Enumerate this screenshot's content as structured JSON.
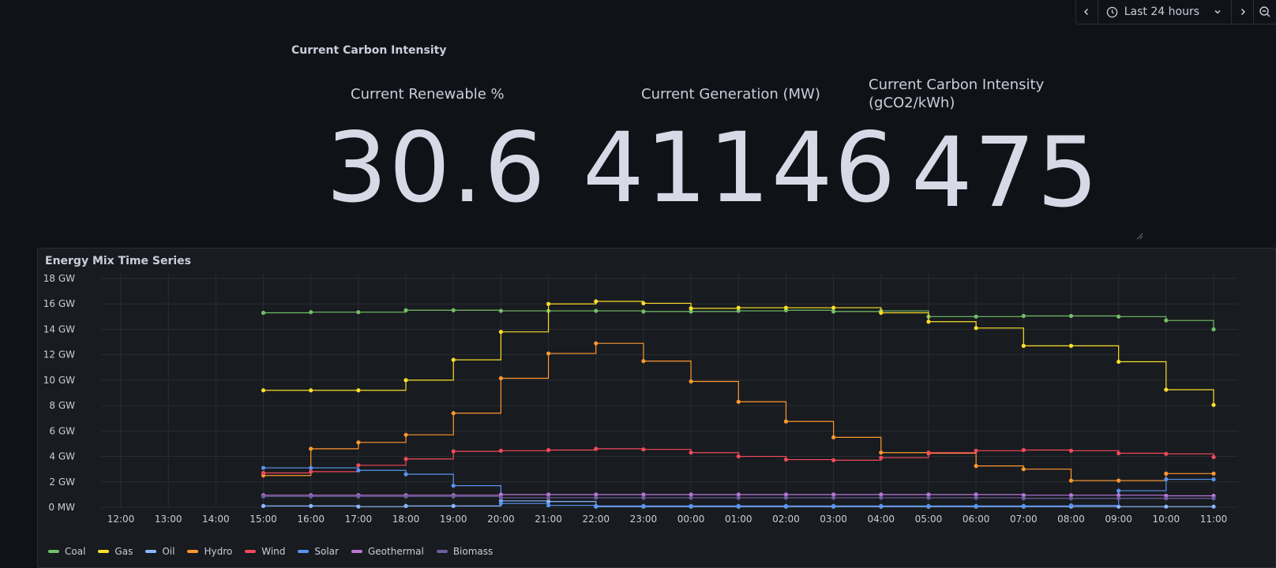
{
  "toolbar": {
    "prev_icon": "chevron-left-icon",
    "time_range": "Last 24 hours",
    "next_icon": "chevron-right-icon",
    "zoom_icon": "zoom-out-icon"
  },
  "stats": {
    "section_title": "Current Carbon Intensity",
    "renewable": {
      "title": "Current Renewable %",
      "value": "30.6"
    },
    "generation": {
      "title": "Current Generation (MW)",
      "value": "41146"
    },
    "carbon": {
      "title_line1": "Current Carbon Intensity",
      "title_line2": "(gCO2/kWh)",
      "value": "475"
    }
  },
  "timeseries": {
    "title": "Energy Mix Time Series"
  },
  "colors": {
    "Coal": "#73bf69",
    "Gas": "#fade2a",
    "Oil": "#8ab8ff",
    "Hydro": "#ff9830",
    "Wind": "#f2495c",
    "Solar": "#5794f2",
    "Geothermal": "#b877d9",
    "Biomass": "#705da0"
  },
  "chart_data": {
    "type": "line",
    "step": true,
    "x": [
      "12:00",
      "13:00",
      "14:00",
      "15:00",
      "16:00",
      "17:00",
      "18:00",
      "19:00",
      "20:00",
      "21:00",
      "22:00",
      "23:00",
      "00:00",
      "01:00",
      "02:00",
      "03:00",
      "04:00",
      "05:00",
      "06:00",
      "07:00",
      "08:00",
      "09:00",
      "10:00",
      "11:00"
    ],
    "y_ticks": [
      "0 MW",
      "2 GW",
      "4 GW",
      "6 GW",
      "8 GW",
      "10 GW",
      "12 GW",
      "14 GW",
      "16 GW",
      "18 GW"
    ],
    "ylim": [
      0,
      18
    ],
    "yunit": "GW",
    "grid": true,
    "legend_position": "bottom",
    "series": [
      {
        "name": "Coal",
        "values": [
          null,
          null,
          null,
          15.3,
          15.35,
          15.35,
          15.5,
          15.5,
          15.45,
          15.45,
          15.45,
          15.4,
          15.4,
          15.45,
          15.5,
          15.4,
          15.45,
          15.0,
          15.0,
          15.05,
          15.05,
          15.0,
          14.7,
          14.0
        ]
      },
      {
        "name": "Gas",
        "values": [
          null,
          null,
          null,
          9.2,
          9.2,
          9.2,
          10.0,
          11.6,
          13.8,
          16.0,
          16.2,
          16.05,
          15.65,
          15.7,
          15.7,
          15.7,
          15.3,
          14.6,
          14.1,
          12.7,
          12.7,
          11.45,
          9.25,
          8.05
        ]
      },
      {
        "name": "Oil",
        "values": [
          null,
          null,
          null,
          0.1,
          0.1,
          0.05,
          0.1,
          0.1,
          0.5,
          0.45,
          0.05,
          0.05,
          0.05,
          0.05,
          0.05,
          0.05,
          0.05,
          0.05,
          0.05,
          0.05,
          0.05,
          0.05,
          0.05,
          0.05
        ]
      },
      {
        "name": "Hydro",
        "values": [
          null,
          null,
          null,
          2.5,
          4.6,
          5.1,
          5.7,
          7.4,
          10.15,
          12.1,
          12.9,
          11.5,
          9.9,
          8.3,
          6.75,
          5.5,
          4.3,
          4.25,
          3.25,
          3.0,
          2.1,
          2.1,
          2.65,
          2.65
        ]
      },
      {
        "name": "Wind",
        "values": [
          null,
          null,
          null,
          2.7,
          2.8,
          3.3,
          3.8,
          4.4,
          4.45,
          4.5,
          4.6,
          4.55,
          4.3,
          4.0,
          3.75,
          3.7,
          3.9,
          4.3,
          4.45,
          4.5,
          4.45,
          4.25,
          4.2,
          3.95
        ]
      },
      {
        "name": "Solar",
        "values": [
          null,
          null,
          null,
          3.1,
          3.1,
          2.9,
          2.6,
          1.7,
          0.3,
          0.15,
          0.1,
          0.1,
          0.1,
          0.1,
          0.1,
          0.1,
          0.1,
          0.1,
          0.1,
          0.1,
          0.15,
          1.3,
          2.2,
          2.2
        ]
      },
      {
        "name": "Geothermal",
        "values": [
          null,
          null,
          null,
          0.95,
          0.95,
          0.95,
          0.95,
          0.95,
          1.0,
          1.0,
          1.0,
          1.0,
          1.0,
          1.0,
          1.0,
          1.0,
          1.0,
          1.0,
          1.0,
          0.95,
          0.95,
          0.95,
          0.9,
          0.9
        ]
      },
      {
        "name": "Biomass",
        "values": [
          null,
          null,
          null,
          0.85,
          0.85,
          0.85,
          0.85,
          0.85,
          0.75,
          0.75,
          0.75,
          0.75,
          0.75,
          0.75,
          0.75,
          0.75,
          0.75,
          0.75,
          0.75,
          0.7,
          0.7,
          0.7,
          0.7,
          0.7
        ]
      }
    ]
  }
}
